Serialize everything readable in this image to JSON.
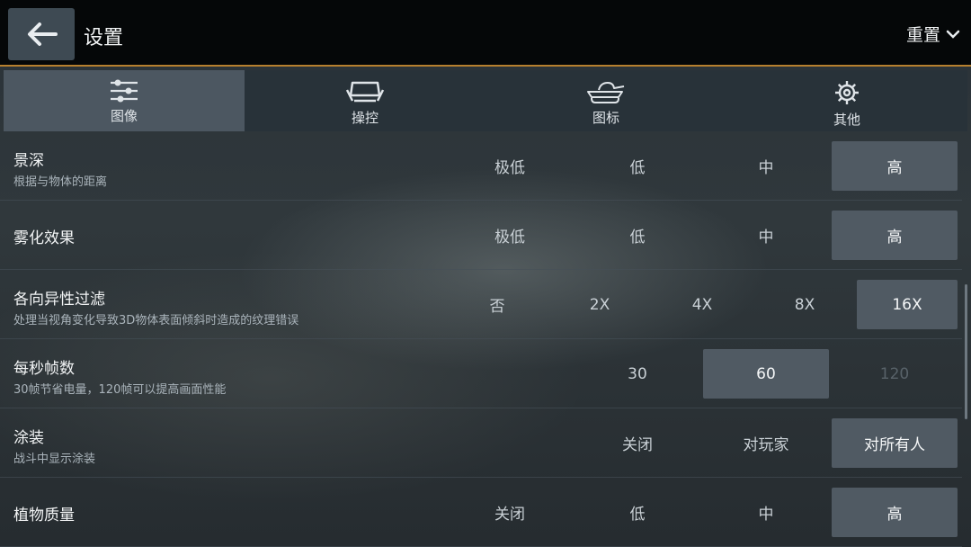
{
  "header": {
    "title": "设置",
    "reset_label": "重置"
  },
  "tabs": [
    {
      "label": "图像",
      "icon": "sliders-icon",
      "active": true
    },
    {
      "label": "操控",
      "icon": "controls-icon",
      "active": false
    },
    {
      "label": "图标",
      "icon": "tank-icon",
      "active": false
    },
    {
      "label": "其他",
      "icon": "gear-icon",
      "active": false
    }
  ],
  "settings": {
    "depth_of_field": {
      "title": "景深",
      "desc": "根据与物体的距离",
      "options": [
        "极低",
        "低",
        "中",
        "高"
      ],
      "selected": "高"
    },
    "fog": {
      "title": "雾化效果",
      "options": [
        "极低",
        "低",
        "中",
        "高"
      ],
      "selected": "高"
    },
    "anisotropic": {
      "title": "各向异性过滤",
      "desc": "处理当视角变化导致3D物体表面倾斜时造成的纹理错误",
      "options": [
        "否",
        "2X",
        "4X",
        "8X",
        "16X"
      ],
      "selected": "16X"
    },
    "fps": {
      "title": "每秒帧数",
      "desc": "30帧节省电量，120帧可以提高画面性能",
      "options": [
        "30",
        "60",
        "120"
      ],
      "selected": "60",
      "disabled": "120"
    },
    "camo": {
      "title": "涂装",
      "desc": "战斗中显示涂装",
      "options": [
        "关闭",
        "对玩家",
        "对所有人"
      ],
      "selected": "对所有人"
    },
    "vegetation": {
      "title": "植物质量",
      "options": [
        "关闭",
        "低",
        "中",
        "高"
      ],
      "selected": "高"
    }
  },
  "colors": {
    "accent": "#b7802e",
    "selected_bg": "#505a63",
    "active_tab_bg": "#4c5761"
  }
}
